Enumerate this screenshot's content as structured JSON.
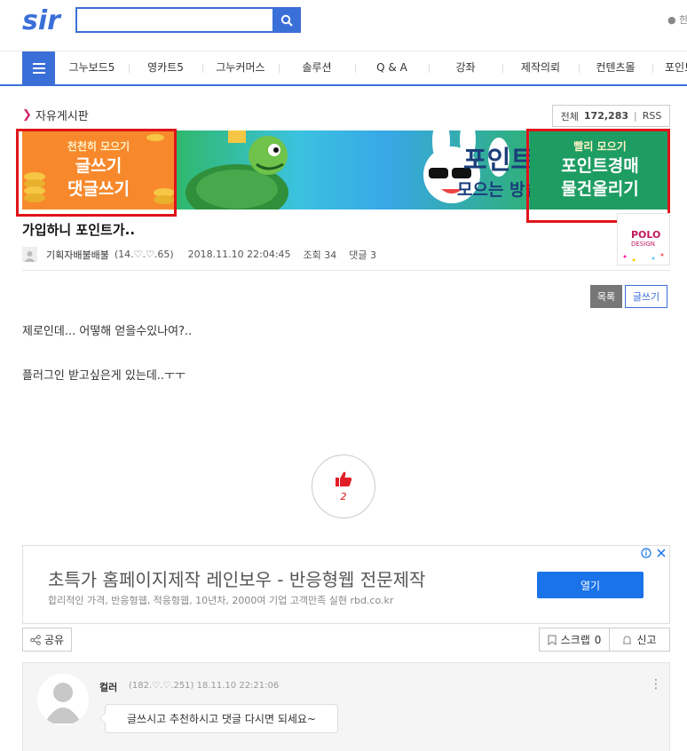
{
  "header": {
    "logo_alt": "sir",
    "search_placeholder": "",
    "user_link": "한"
  },
  "nav": {
    "items": [
      "그누보드5",
      "영카트5",
      "그누커머스",
      "솔루션",
      "Q & A",
      "강좌",
      "제작의뢰",
      "컨텐츠몰",
      "포인트"
    ]
  },
  "board": {
    "title": "자유게시판",
    "count_label": "전체",
    "count_value": "172,283",
    "rss": "RSS"
  },
  "banner": {
    "left_small": "천천히 모으기",
    "left_line1": "글쓰기",
    "left_line2": "댓글쓰기",
    "mid_title": "포인트",
    "mid_sub": "모으는 방법",
    "right_small": "빨리 모으기",
    "right_line1": "포인트경매",
    "right_line2": "물건올리기"
  },
  "post": {
    "title": "가입하니 포인트가..",
    "author": "기획자배불배불",
    "ip": "(14.♡.♡.65)",
    "date": "2018.11.10 22:04:45",
    "views": "조회 34",
    "comments": "댓글 3",
    "body_line1": "제로인데... 어떻해 얻을수있나여?..",
    "body_line2": "플러그인 받고싶은게 있는데..ㅜㅜ",
    "like_count": "2"
  },
  "ad_thumb": {
    "brand": "POLO",
    "sub": "DESIGN"
  },
  "buttons": {
    "list": "목록",
    "write": "글쓰기",
    "share": "공유",
    "scrap": "스크랩",
    "scrap_count": "0",
    "report": "신고"
  },
  "ad": {
    "title": "초특가 홈페이지제작 레인보우 - 반응형웹 전문제작",
    "subtitle": "합리적인 가격, 반응형웹, 적응형웹, 10년차, 2000여 기업 고객만족 실현 rbd.co.kr",
    "cta": "열기"
  },
  "comment": {
    "author": "컬러",
    "info": "(182.♡.♡.251) 18.11.10 22:21:06",
    "text": "글쓰시고 추천하시고 댓글 다시면 되세요~"
  },
  "colors": {
    "brand_blue": "#3a6fd8",
    "accent_pink": "#d1236a",
    "highlight_red": "#e0141a",
    "ad_button": "#1a73e8"
  }
}
